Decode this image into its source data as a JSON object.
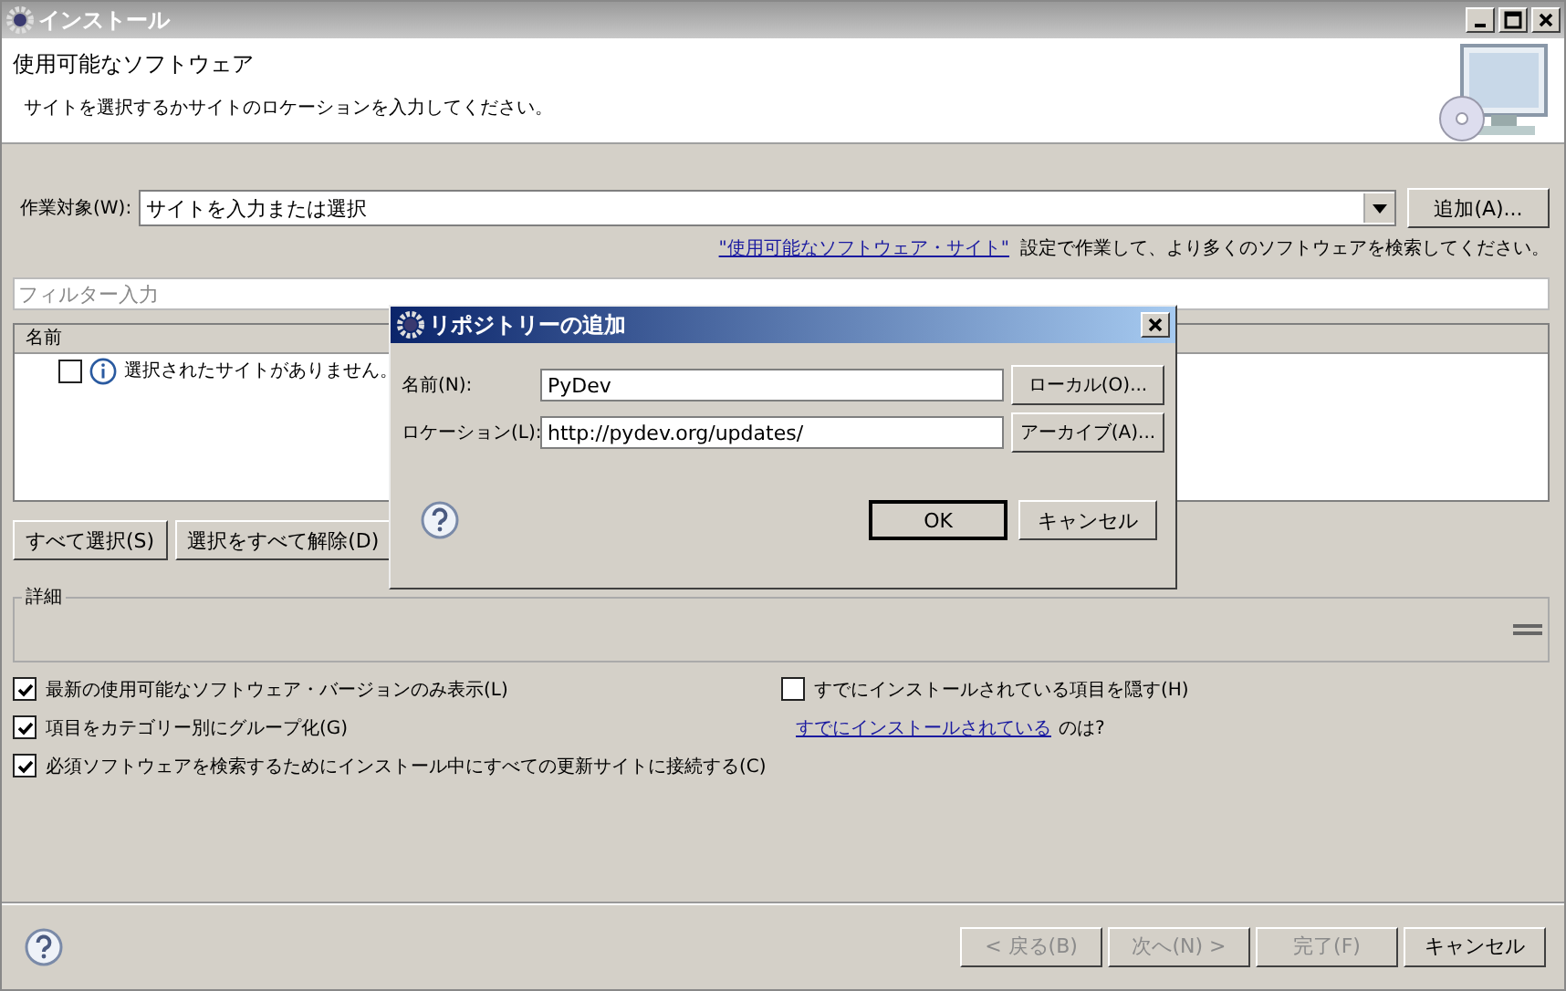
{
  "window": {
    "title": "インストール"
  },
  "header": {
    "title": "使用可能なソフトウェア",
    "message": "サイトを選択するかサイトのロケーションを入力してください。"
  },
  "work_with": {
    "label": "作業対象(W):",
    "value": "サイトを入力または選択",
    "add_button": "追加(A)..."
  },
  "hint": {
    "link": "\"使用可能なソフトウェア・サイト\"",
    "text": "設定で作業して、より多くのソフトウェアを検索してください。"
  },
  "filter": {
    "placeholder": "フィルター入力"
  },
  "table": {
    "columns": [
      "名前"
    ],
    "rows": [
      {
        "checked": false,
        "text": "選択されたサイトがありません。"
      }
    ]
  },
  "selection_buttons": [
    "すべて選択(S)",
    "選択をすべて解除(D)"
  ],
  "details": {
    "label": "詳細"
  },
  "options_left": [
    {
      "label": "最新の使用可能なソフトウェア・バージョンのみ表示(L)",
      "checked": true
    },
    {
      "label": "項目をカテゴリー別にグループ化(G)",
      "checked": true
    },
    {
      "label": "必須ソフトウェアを検索するためにインストール中にすべての更新サイトに接続する(C)",
      "checked": true
    }
  ],
  "options_right": {
    "checkbox": {
      "label": "すでにインストールされている項目を隠す(H)",
      "checked": false
    },
    "link": "すでにインストールされている",
    "link_suffix": "のは?"
  },
  "footer_buttons": [
    {
      "label": "< 戻る(B)",
      "disabled": true
    },
    {
      "label": "次へ(N) >",
      "disabled": true
    },
    {
      "label": "完了(F)",
      "disabled": true
    },
    {
      "label": "キャンセル",
      "disabled": false
    }
  ],
  "dialog": {
    "title": "リポジトリーの追加",
    "fields": [
      {
        "label": "名前(N):",
        "value": "PyDev",
        "button": "ローカル(O)..."
      },
      {
        "label": "ロケーション(L):",
        "value": "http://pydev.org/updates/",
        "button": "アーカイブ(A)..."
      }
    ],
    "ok": "OK",
    "cancel": "キャンセル"
  }
}
